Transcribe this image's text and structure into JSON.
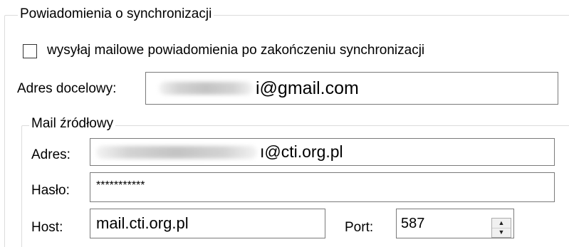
{
  "groups": {
    "sync_notifications_title": "Powiadomienia o synchronizacji",
    "source_mail_title": "Mail źródłowy"
  },
  "send_email_checkbox": {
    "label": "wysyłaj mailowe powiadomienia po zakończeniu synchronizacji",
    "checked": false
  },
  "destination": {
    "label": "Adres docelowy:",
    "value_visible": "i@gmail.com"
  },
  "source": {
    "address_label": "Adres:",
    "address_value_visible": "ı@cti.org.pl",
    "password_label": "Hasło:",
    "password_value": "***********",
    "host_label": "Host:",
    "host_value": "mail.cti.org.pl",
    "port_label": "Port:",
    "port_value": "587"
  },
  "icons": {
    "spinner_up": "up-arrow-icon",
    "spinner_down": "down-arrow-icon"
  }
}
